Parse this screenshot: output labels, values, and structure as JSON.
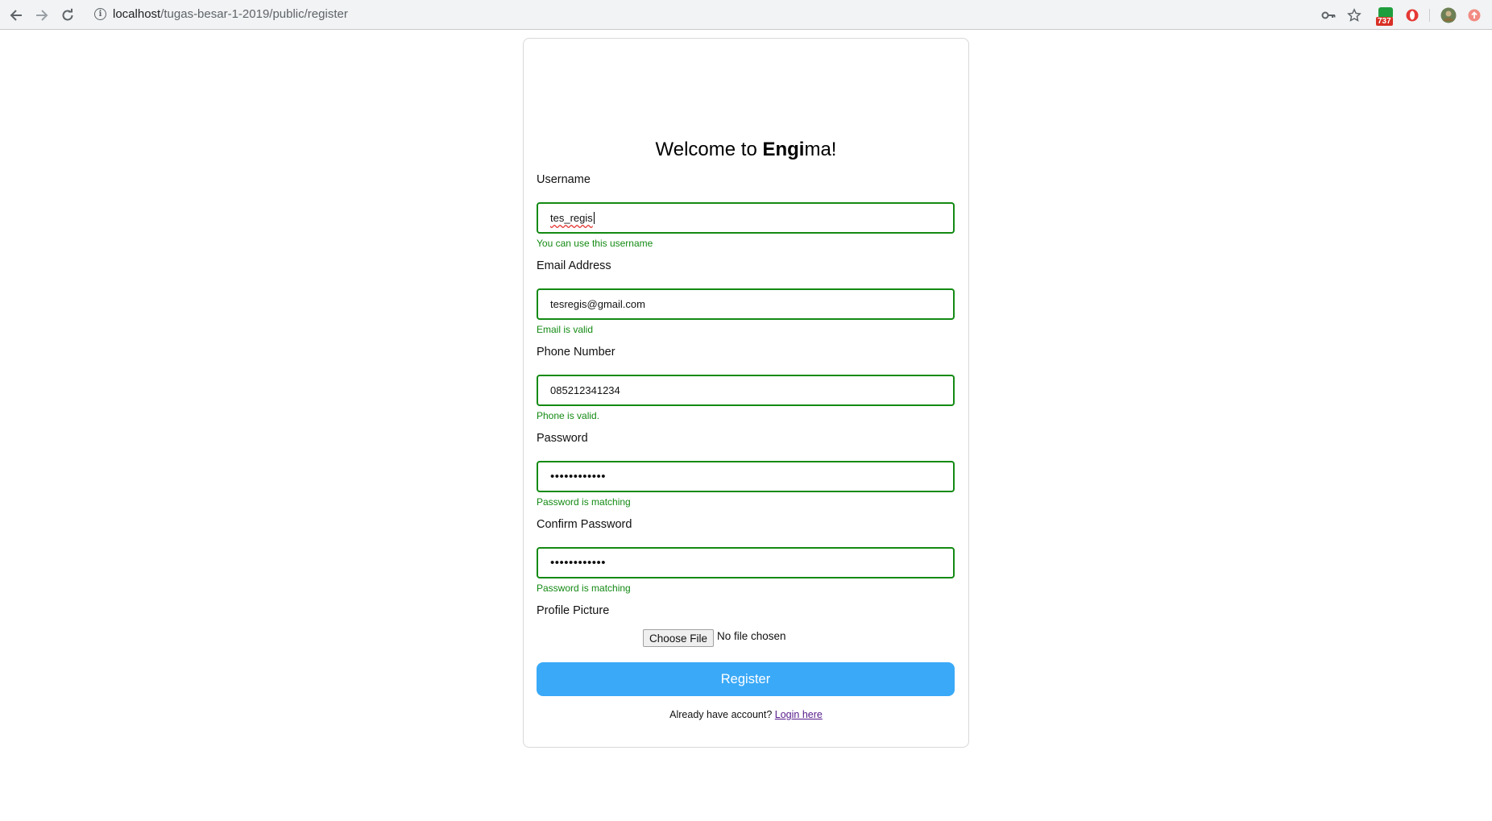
{
  "browser": {
    "url_host": "localhost",
    "url_path": "/tugas-besar-1-2019/public/register",
    "extension_badge_count": "737"
  },
  "page": {
    "heading_prefix": "Welcome to ",
    "heading_bold": "Engi",
    "heading_suffix": "ma!"
  },
  "form": {
    "username": {
      "label": "Username",
      "value": "tes_regis",
      "hint": "You can use this username"
    },
    "email": {
      "label": "Email Address",
      "value": "tesregis@gmail.com",
      "hint": "Email is valid"
    },
    "phone": {
      "label": "Phone Number",
      "value": "085212341234",
      "hint": "Phone is valid."
    },
    "password": {
      "label": "Password",
      "value": "••••••••••••",
      "hint": "Password is matching"
    },
    "confirm_password": {
      "label": "Confirm Password",
      "value": "••••••••••••",
      "hint": "Password is matching"
    },
    "profile_picture": {
      "label": "Profile Picture",
      "button_label": "Choose File",
      "status": "No file chosen"
    },
    "submit_label": "Register",
    "login_prompt": "Already have account? ",
    "login_link": "Login here"
  },
  "colors": {
    "valid_green": "#138a13",
    "button_blue": "#3aa9f8",
    "link_purple": "#551a8b"
  },
  "icons": [
    "back-arrow-icon",
    "forward-arrow-icon",
    "reload-icon",
    "info-icon",
    "key-icon",
    "star-icon",
    "extension-badge-icon",
    "opera-icon",
    "avatar",
    "update-icon"
  ]
}
